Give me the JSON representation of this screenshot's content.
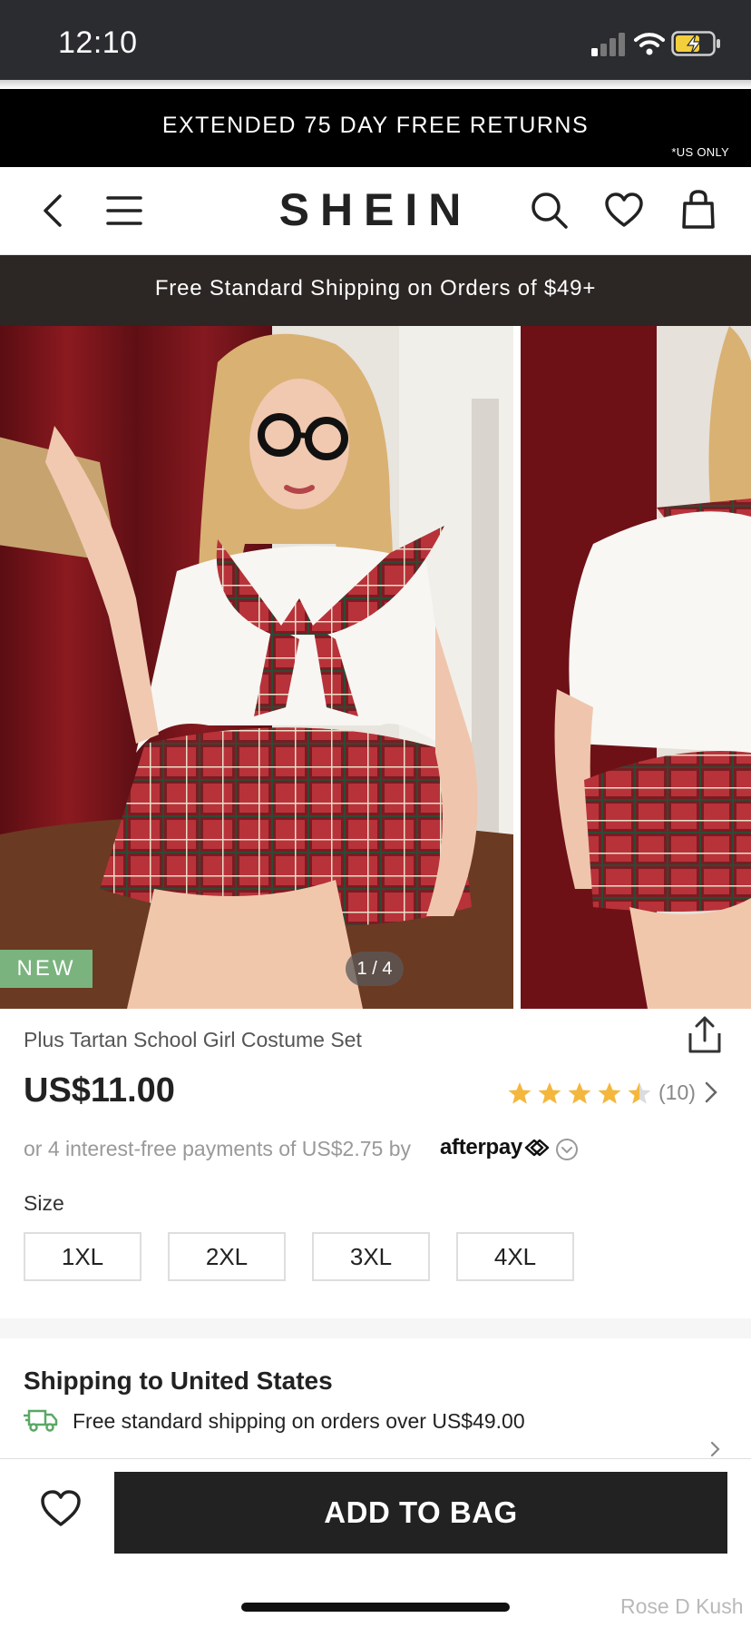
{
  "status": {
    "time": "12:10"
  },
  "promo": {
    "text": "EXTENDED 75 DAY FREE RETURNS",
    "note": "*US ONLY"
  },
  "nav": {
    "logo": "SHEIN"
  },
  "shipping_strip": {
    "text": "Free Standard Shipping on Orders of $49+"
  },
  "gallery": {
    "badge": "NEW",
    "counter": "1 / 4"
  },
  "product": {
    "title": "Plus Tartan School Girl Costume Set",
    "price": "US$11.00",
    "rating": 4.5,
    "review_count": "(10)",
    "installments": "or 4 interest-free payments of US$2.75 by",
    "afterpay": "afterpay",
    "size_label": "Size",
    "sizes": [
      "1XL",
      "2XL",
      "3XL",
      "4XL"
    ]
  },
  "shipping": {
    "heading": "Shipping to United States",
    "line": "Free standard shipping on orders over US$49.00"
  },
  "bottom": {
    "add_to_bag": "ADD TO BAG"
  },
  "watermark": "Rose D Kush",
  "colors": {
    "badge_green": "#7ab37e",
    "star_gold": "#f4b73d",
    "dark": "#222222",
    "strip_brown": "#2c2624"
  }
}
